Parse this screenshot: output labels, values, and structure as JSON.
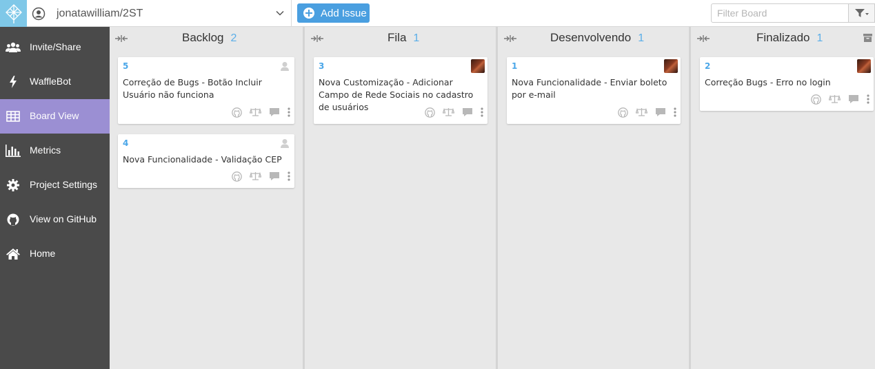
{
  "app": {
    "repo_name": "jonatawilliam/2ST",
    "add_issue_label": "Add Issue",
    "filter_placeholder": "Filter Board"
  },
  "colors": {
    "accent_blue": "#4a9fe0",
    "sidebar_bg": "#4a4a4a",
    "sidebar_active": "#9b8fd3",
    "logo_bg": "#7fc8e8",
    "count_blue": "#5aaee8"
  },
  "sidebar": {
    "items": [
      {
        "label": "Invite/Share",
        "icon": "users-icon"
      },
      {
        "label": "WaffleBot",
        "icon": "lightning-icon"
      },
      {
        "label": "Board View",
        "icon": "grid-icon",
        "active": true
      },
      {
        "label": "Metrics",
        "icon": "bar-chart-icon"
      },
      {
        "label": "Project Settings",
        "icon": "gear-icon"
      },
      {
        "label": "View on GitHub",
        "icon": "github-icon"
      },
      {
        "label": "Home",
        "icon": "home-icon"
      }
    ]
  },
  "columns": [
    {
      "title": "Backlog",
      "count": "2",
      "cards": [
        {
          "number": "5",
          "title": "Correção de Bugs - Botão Incluir Usuário não funciona",
          "assigned": false
        },
        {
          "number": "4",
          "title": "Nova Funcionalidade - Validação CEP",
          "assigned": false
        }
      ]
    },
    {
      "title": "Fila",
      "count": "1",
      "cards": [
        {
          "number": "3",
          "title": "Nova Customização - Adicionar Campo de Rede Sociais no cadastro de usuários",
          "assigned": true
        }
      ]
    },
    {
      "title": "Desenvolvendo",
      "count": "1",
      "cards": [
        {
          "number": "1",
          "title": "Nova Funcionalidade - Enviar boleto por e-mail",
          "assigned": true
        }
      ]
    },
    {
      "title": "Finalizado",
      "count": "1",
      "cards": [
        {
          "number": "2",
          "title": "Correção Bugs - Erro no login",
          "assigned": true
        }
      ]
    }
  ]
}
